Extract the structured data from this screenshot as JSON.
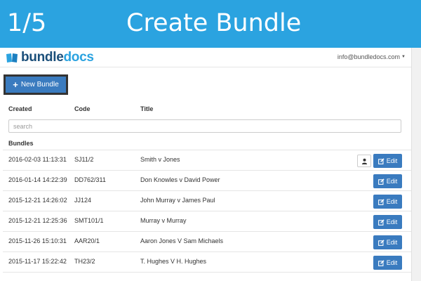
{
  "banner": {
    "step": "1/5",
    "title": "Create Bundle",
    "color": "#2ba3e0"
  },
  "app": {
    "logo": {
      "part1": "bundle",
      "part2": "docs"
    },
    "account_email": "info@bundledocs.com"
  },
  "toolbar": {
    "new_bundle_label": "New Bundle"
  },
  "table": {
    "headers": {
      "created": "Created",
      "code": "Code",
      "title": "Title"
    },
    "search_placeholder": "search",
    "section_label": "Bundles",
    "edit_label": "Edit",
    "rows": [
      {
        "created": "2016-02-03 11:13:31",
        "code": "SJ11/2",
        "title": "Smith v Jones",
        "has_user_icon": true
      },
      {
        "created": "2016-01-14 14:22:39",
        "code": "DD762/311",
        "title": "Don Knowles v David Power",
        "has_user_icon": false
      },
      {
        "created": "2015-12-21 14:26:02",
        "code": "JJ124",
        "title": "John Murray v James Paul",
        "has_user_icon": false
      },
      {
        "created": "2015-12-21 12:25:36",
        "code": "SMT101/1",
        "title": "Murray v Murray",
        "has_user_icon": false
      },
      {
        "created": "2015-11-26 15:10:31",
        "code": "AAR20/1",
        "title": "Aaron Jones V Sam Michaels",
        "has_user_icon": false
      },
      {
        "created": "2015-11-17 15:22:42",
        "code": "TH23/2",
        "title": "T. Hughes V H. Hughes",
        "has_user_icon": false
      }
    ]
  },
  "colors": {
    "accent": "#3a7bbf",
    "brand_dark": "#1b4f7a"
  }
}
